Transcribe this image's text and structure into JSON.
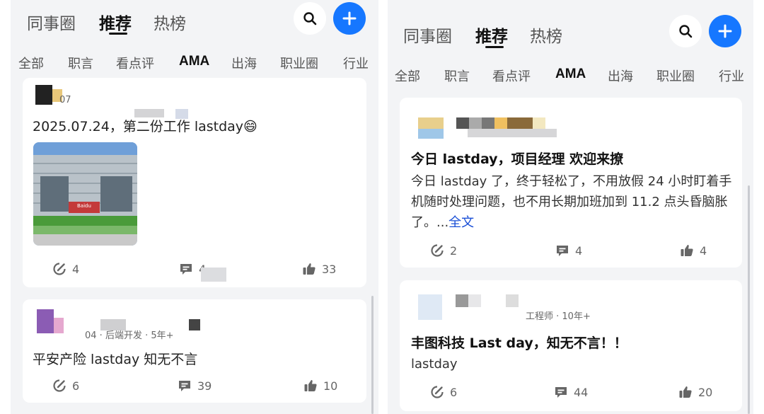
{
  "left": {
    "tabs": [
      "同事圈",
      "推荐",
      "热榜"
    ],
    "categories": [
      "全部",
      "职言",
      "看点评",
      "AMA",
      "出海",
      "职业圈",
      "行业"
    ],
    "post1": {
      "text": "2025.07.24，第二份工作 lastday",
      "emoji": "😄",
      "meta": "07",
      "stats": {
        "edit": "4",
        "comments": "4",
        "likes": "33"
      },
      "photo_sign": "Baidu"
    },
    "post2": {
      "meta": "04 · 后端开发 · 5年+",
      "text": "平安产险 lastday 知无不言",
      "stats": {
        "edit": "6",
        "comments": "39",
        "likes": "10"
      }
    }
  },
  "right": {
    "tabs": [
      "同事圈",
      "推荐",
      "热榜"
    ],
    "categories": [
      "全部",
      "职言",
      "看点评",
      "AMA",
      "出海",
      "职业圈",
      "行业"
    ],
    "post1": {
      "title": "今日 lastday，项目经理  欢迎来撩",
      "body": "今日 lastday 了，终于轻松了，不用放假 24 小时盯着手机随时处理问题，也不用长期加班加到 11.2 点头昏脑胀了。...",
      "more": "全文",
      "stats": {
        "edit": "2",
        "comments": "4",
        "likes": "4"
      }
    },
    "post2": {
      "meta": "工程师 · 10年+",
      "title": "丰图科技 Last  day，知无不言！！",
      "body": "lastday",
      "stats": {
        "edit": "6",
        "comments": "44",
        "likes": "20"
      }
    }
  },
  "colors": {
    "accent": "#1677ff",
    "link": "#1a4fd6",
    "background": "#f3f4f6"
  },
  "icons": [
    "search-icon",
    "plus-icon",
    "edit-icon",
    "comment-icon",
    "thumbs-up-icon"
  ]
}
